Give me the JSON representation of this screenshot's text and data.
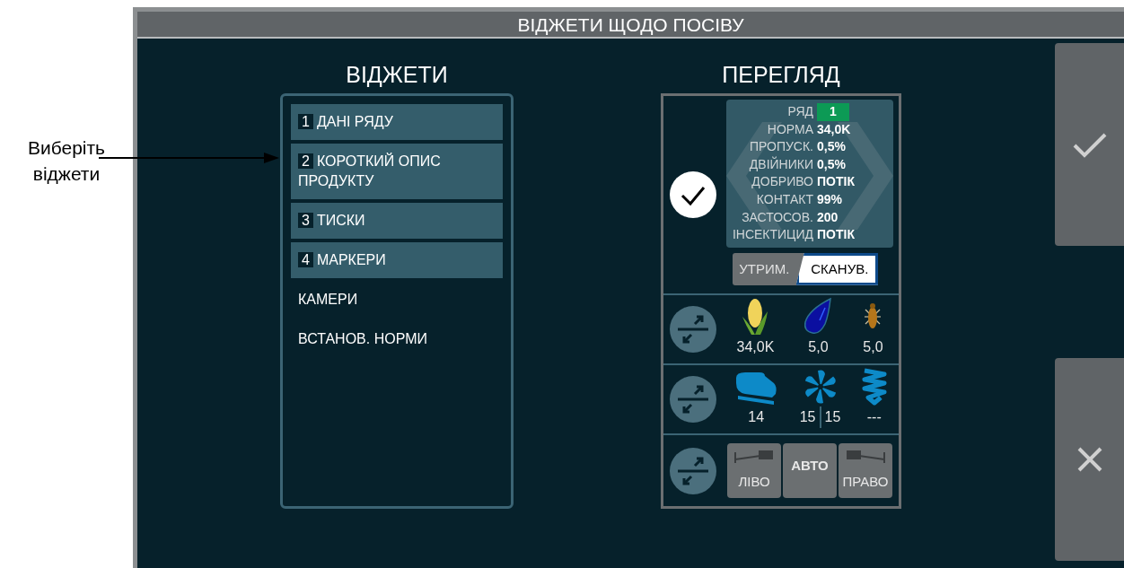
{
  "callout": {
    "text": "Виберіть віджети"
  },
  "window": {
    "title": "ВІДЖЕТИ ЩОДО ПОСІВУ"
  },
  "widgets": {
    "title": "ВІДЖЕТИ",
    "items": [
      {
        "number": "1",
        "label": "ДАНІ РЯДУ",
        "selected": true
      },
      {
        "number": "2",
        "label": "КОРОТКИЙ ОПИС ПРОДУКТУ",
        "selected": true
      },
      {
        "number": "3",
        "label": "ТИСКИ",
        "selected": true
      },
      {
        "number": "4",
        "label": "МАРКЕРИ",
        "selected": true
      },
      {
        "label": "КАМЕРИ",
        "selected": false
      },
      {
        "label": "ВСТАНОВ. НОРМИ",
        "selected": false
      }
    ]
  },
  "preview": {
    "title": "ПЕРЕГЛЯД",
    "row_data": {
      "checked": true,
      "rows": [
        {
          "label": "РЯД",
          "value": "1",
          "kind": "badge"
        },
        {
          "label": "НОРМА",
          "value": "34,0K",
          "kind": "text"
        },
        {
          "label": "ПРОПУСК.",
          "value": "0,5%",
          "kind": "text"
        },
        {
          "label": "ДВІЙНИКИ",
          "value": "0,5%",
          "kind": "text"
        },
        {
          "label": "ДОБРИВО",
          "value": "ПОТІК",
          "kind": "text"
        },
        {
          "label": "КОНТАКТ",
          "value": "99%",
          "kind": "text"
        },
        {
          "label": "ЗАСТОСОВ.",
          "value": "200",
          "kind": "text"
        },
        {
          "label": "ІНСЕКТИЦИД",
          "value": "ПОТІК",
          "kind": "text"
        }
      ]
    },
    "mode_toggle": [
      {
        "label": "УТРИМ.",
        "selected": false
      },
      {
        "label": "СКАНУВ.",
        "selected": true
      }
    ],
    "product_row": [
      {
        "kind": "corn",
        "values": [
          "34,0K"
        ]
      },
      {
        "kind": "drop",
        "values": [
          "5,0"
        ]
      },
      {
        "kind": "bug",
        "values": [
          "5,0"
        ]
      }
    ],
    "pressure_row": [
      {
        "kind": "tank",
        "values": [
          "14"
        ]
      },
      {
        "kind": "fan",
        "values": [
          "15",
          "15"
        ]
      },
      {
        "kind": "spring",
        "values": [
          "---"
        ]
      }
    ],
    "marker_buttons": [
      {
        "kind": "left",
        "label": "ЛІВО"
      },
      {
        "kind": "auto",
        "label": "АВТО"
      },
      {
        "kind": "right",
        "label": "ПРАВО"
      }
    ]
  },
  "actions": [
    {
      "kind": "confirm"
    },
    {
      "kind": "cancel"
    }
  ]
}
